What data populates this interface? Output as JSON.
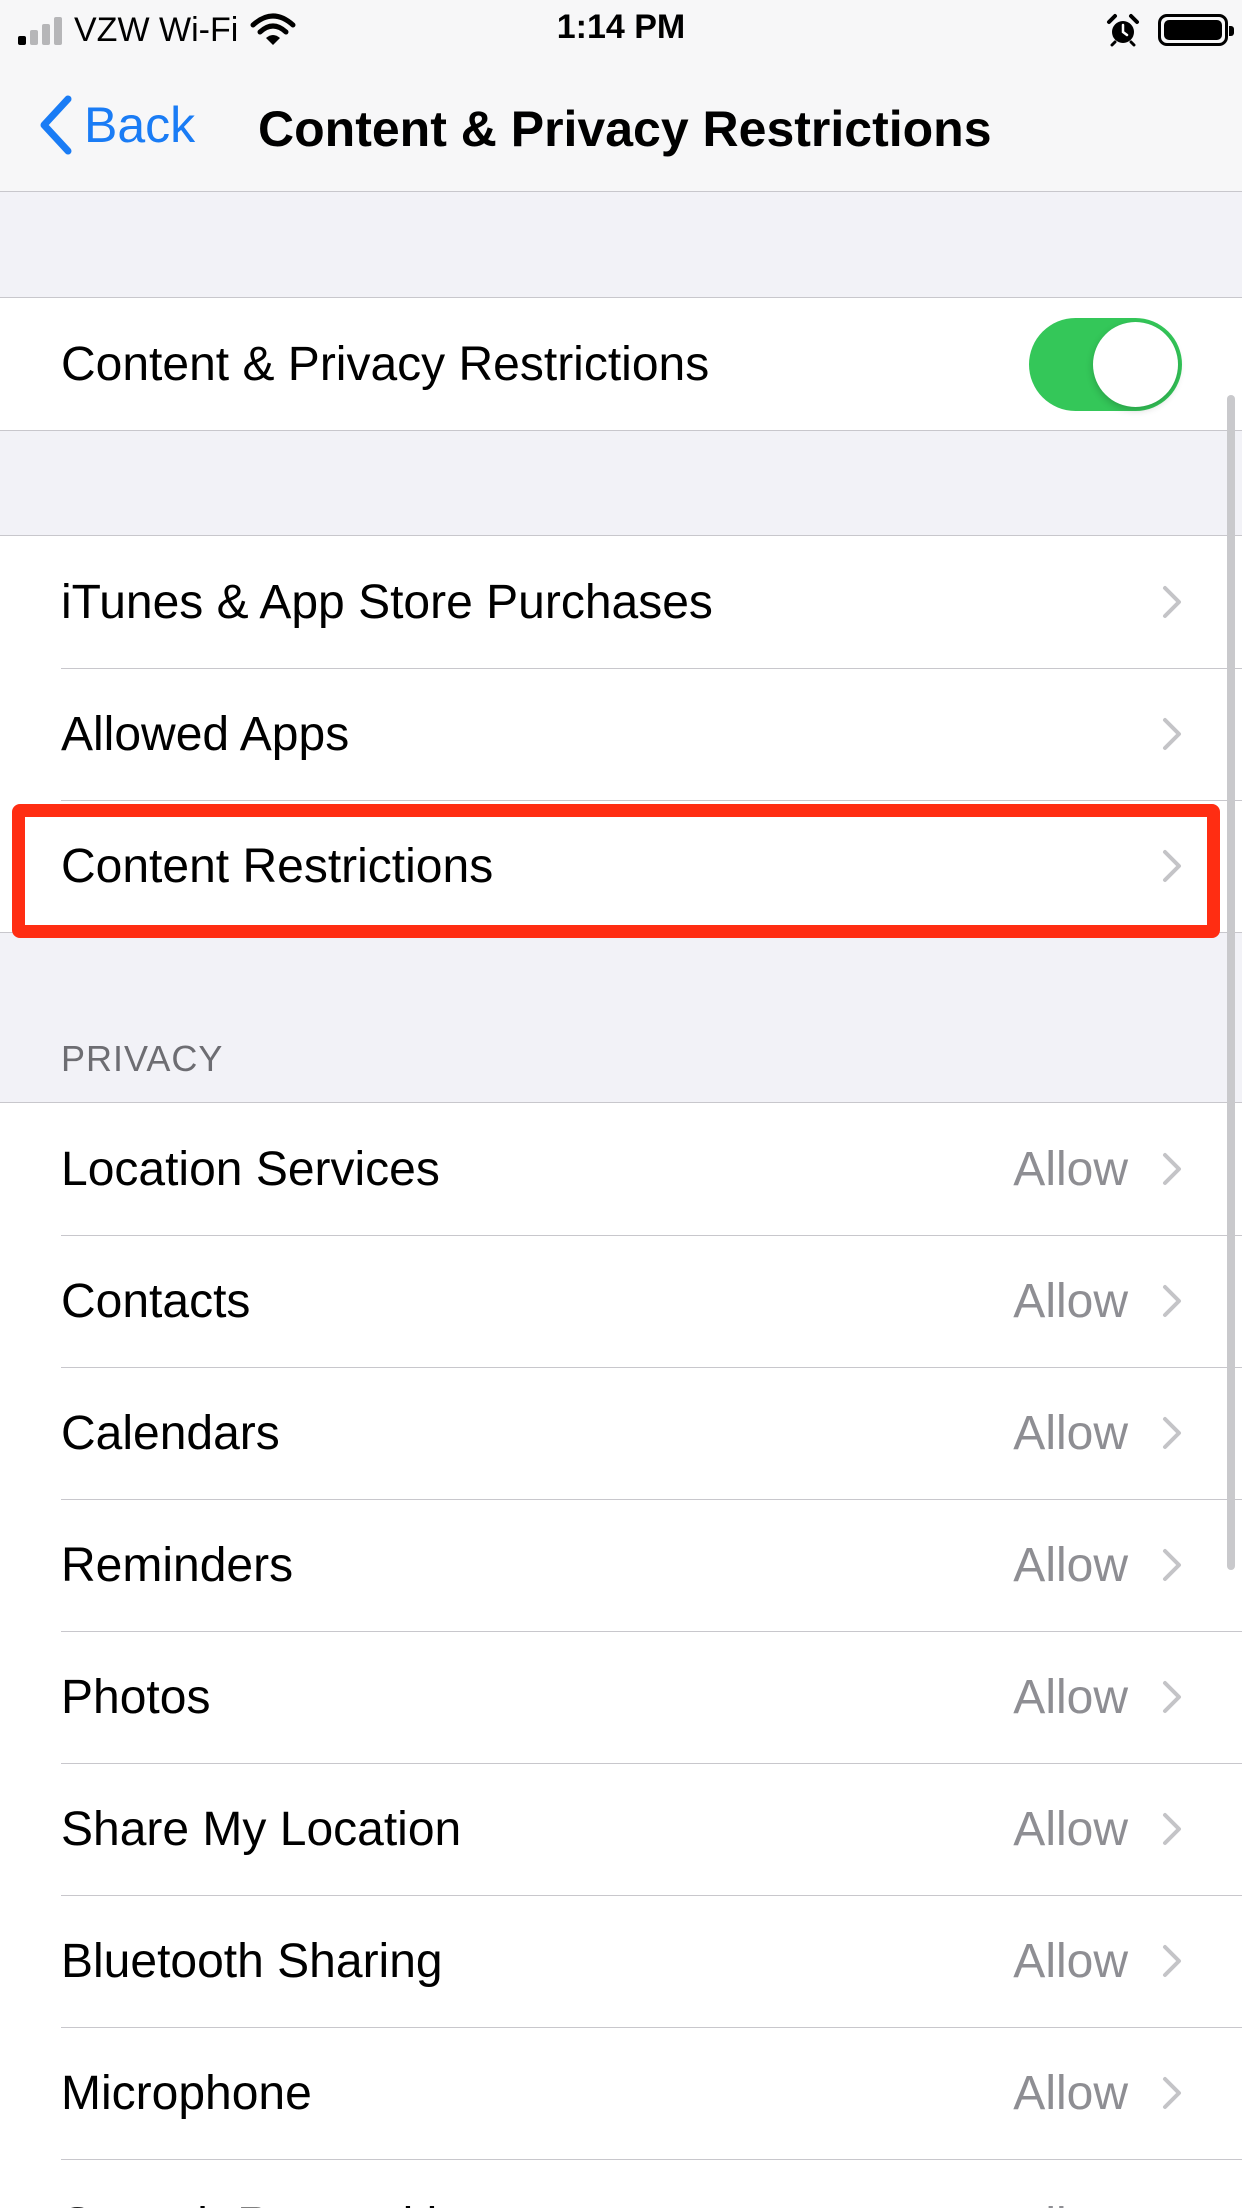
{
  "status_bar": {
    "carrier": "VZW Wi-Fi",
    "time": "1:14 PM"
  },
  "nav": {
    "back_label": "Back",
    "title": "Content & Privacy Restrictions"
  },
  "master": {
    "label": "Content & Privacy Restrictions",
    "enabled": true
  },
  "store_group": [
    {
      "label": "iTunes & App Store Purchases"
    },
    {
      "label": "Allowed Apps"
    },
    {
      "label": "Content Restrictions"
    }
  ],
  "privacy": {
    "header": "PRIVACY",
    "items": [
      {
        "label": "Location Services",
        "value": "Allow"
      },
      {
        "label": "Contacts",
        "value": "Allow"
      },
      {
        "label": "Calendars",
        "value": "Allow"
      },
      {
        "label": "Reminders",
        "value": "Allow"
      },
      {
        "label": "Photos",
        "value": "Allow"
      },
      {
        "label": "Share My Location",
        "value": "Allow"
      },
      {
        "label": "Bluetooth Sharing",
        "value": "Allow"
      },
      {
        "label": "Microphone",
        "value": "Allow"
      },
      {
        "label": "Speech Recognition",
        "value": "Allow"
      }
    ]
  },
  "colors": {
    "accent": "#1a7cf5",
    "toggle_on": "#34c759",
    "highlight": "#ff2d12"
  }
}
